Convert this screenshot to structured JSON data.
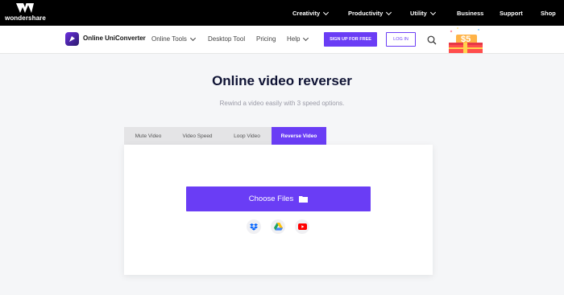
{
  "topbar": {
    "brand": "wondershare",
    "nav": [
      {
        "label": "Creativity",
        "dropdown": true
      },
      {
        "label": "Productivity",
        "dropdown": true
      },
      {
        "label": "Utility",
        "dropdown": true
      },
      {
        "label": "Business",
        "dropdown": false
      },
      {
        "label": "Support",
        "dropdown": false
      },
      {
        "label": "Shop",
        "dropdown": false
      }
    ]
  },
  "mainnav": {
    "product": "Online UniConverter",
    "links": [
      {
        "label": "Online Tools",
        "dropdown": true
      },
      {
        "label": "Desktop Tool",
        "dropdown": false
      },
      {
        "label": "Pricing",
        "dropdown": false
      },
      {
        "label": "Help",
        "dropdown": true
      }
    ],
    "signup_label": "SIGN UP FOR FREE",
    "login_label": "LOG IN",
    "promo_label": "$5"
  },
  "hero": {
    "title": "Online video reverser",
    "subtitle": "Rewind a video easily with 3 speed options."
  },
  "tabs": [
    {
      "label": "Mute Video",
      "active": false
    },
    {
      "label": "Video Speed",
      "active": false
    },
    {
      "label": "Loop Video",
      "active": false
    },
    {
      "label": "Reverse Video",
      "active": true
    }
  ],
  "upload": {
    "button_label": "Choose Files",
    "sources": [
      "dropbox-icon",
      "google-drive-icon",
      "youtube-icon"
    ]
  },
  "colors": {
    "accent": "#6a3df5",
    "topbar": "#000000",
    "title": "#0f1334"
  }
}
